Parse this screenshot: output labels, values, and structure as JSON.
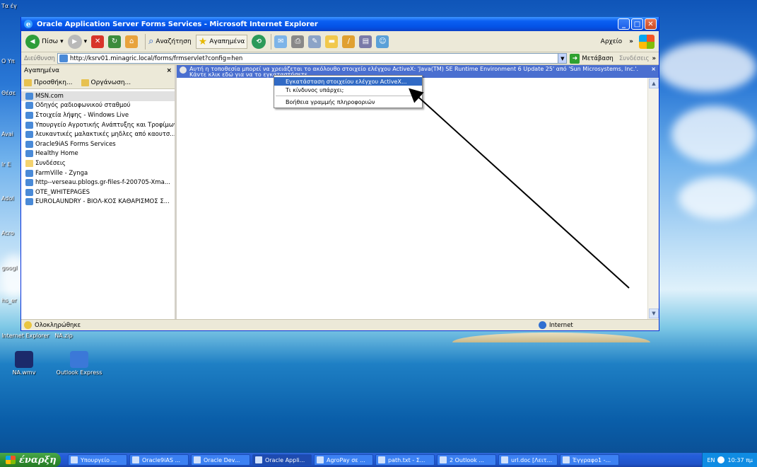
{
  "window": {
    "title": "Oracle Application Server Forms Services - Microsoft Internet Explorer",
    "minimize": "_",
    "maximize": "□",
    "close": "✕"
  },
  "toolbar": {
    "back_label": "Πίσω",
    "search_label": "Αναζήτηση",
    "favorites_label": "Αγαπημένα",
    "menu_label": "Αρχείο",
    "chevron": "»"
  },
  "address": {
    "label": "Διεύθυνση",
    "url": "http://ksrv01.minagric.local/forms/frmservlet?config=hen",
    "go_label": "Μετάβαση",
    "links_label": "Συνδέσεις",
    "chevron": "»"
  },
  "favorites": {
    "header": "Αγαπημένα",
    "close": "×",
    "add_label": "Προσθήκη...",
    "organize_label": "Οργάνωση...",
    "items": [
      {
        "label": "MSN.com",
        "type": "page"
      },
      {
        "label": "Οδηγός ραδιοφωνικού σταθμού",
        "type": "page"
      },
      {
        "label": "Στοιχεία λήψης - Windows Live",
        "type": "page"
      },
      {
        "label": "Υπουργείο Αγροτικής Ανάπτυξης και Τροφίμων",
        "type": "page"
      },
      {
        "label": "λευκαντικές μαλακτικές μηδλες από καουτσ...",
        "type": "page"
      },
      {
        "label": "Oracle9iAS Forms Services",
        "type": "page"
      },
      {
        "label": "Healthy Home",
        "type": "page"
      },
      {
        "label": "Συνδέσεις",
        "type": "folder"
      },
      {
        "label": "FarmVille - Zynga",
        "type": "page"
      },
      {
        "label": "http--verseau.pblogs.gr-files-f-200705-Xma...",
        "type": "page"
      },
      {
        "label": "OTE_WHITEPAGES",
        "type": "page"
      },
      {
        "label": "EUROLAUNDRY - ΒΙΟΛ-ΚΟΣ ΚΑΘΑΡΙΣΜΟΣ Σ...",
        "type": "page"
      }
    ]
  },
  "infobar": {
    "text": "Αυτή η τοποθεσία μπορεί να χρειάζεται το ακόλουθο στοιχείο ελέγχου ActiveX: 'Java(TM) SE Runtime Environment 6 Update 25' από 'Sun Microsystems, Inc.'. Κάντε κλικ εδώ για να το εγκαταστήσετε...",
    "close": "×"
  },
  "context_menu": {
    "items": [
      "Εγκατάσταση στοιχείου ελέγχου ActiveX...",
      "Τι κίνδυνος υπάρχει;",
      "Βοήθεια γραμμής πληροφοριών"
    ]
  },
  "status": {
    "text": "Ολοκληρώθηκε",
    "zone": "Internet"
  },
  "desktop": {
    "icons": [
      "NA.wmv",
      "Outlook Express"
    ],
    "top_labels": [
      "Internet Explorer",
      "NA.zip"
    ],
    "edge_labels": [
      "Τα έγ",
      "Ο Υπ",
      "Θέσε",
      "Avai",
      "Ir E",
      "Adol",
      "Acro",
      "googl",
      "hs_er"
    ]
  },
  "taskbar": {
    "start_label": "έναρξη",
    "tasks": [
      "Υπουργείο ...",
      "Oracle9iAS ...",
      "Oracle Dev...",
      "Oracle Appli...",
      "AgroPay σε ...",
      "path.txt - Σ...",
      "2 Outlook ...",
      "url.doc [Λειτ...",
      "Έγγραφο1 -..."
    ],
    "active_task_index": 3,
    "tray_lang": "EN",
    "clock": "10:37 πμ"
  },
  "colors": {
    "title_blue": "#0452e6",
    "infobar_blue": "#4a6fd0",
    "selection": "#316ac5",
    "start_green": "#2e8b2e"
  }
}
